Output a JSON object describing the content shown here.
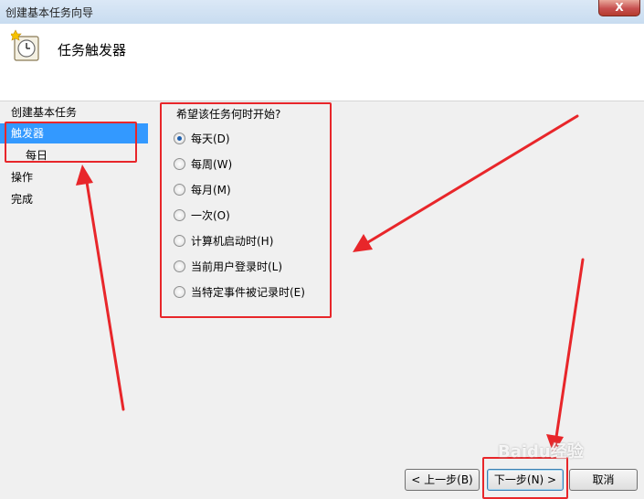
{
  "window": {
    "title": "创建基本任务向导",
    "close_glyph": "X"
  },
  "header": {
    "title": "任务触发器",
    "icon": "clock-icon"
  },
  "sidebar": {
    "items": [
      {
        "label": "创建基本任务",
        "selected": false
      },
      {
        "label": "触发器",
        "selected": true
      },
      {
        "label": "每日",
        "selected": false
      },
      {
        "label": "操作",
        "selected": false
      },
      {
        "label": "完成",
        "selected": false
      }
    ]
  },
  "main": {
    "question": "希望该任务何时开始?",
    "options": [
      {
        "label": "每天(D)",
        "checked": true
      },
      {
        "label": "每周(W)",
        "checked": false
      },
      {
        "label": "每月(M)",
        "checked": false
      },
      {
        "label": "一次(O)",
        "checked": false
      },
      {
        "label": "计算机启动时(H)",
        "checked": false
      },
      {
        "label": "当前用户登录时(L)",
        "checked": false
      },
      {
        "label": "当特定事件被记录时(E)",
        "checked": false
      }
    ]
  },
  "buttons": {
    "back": "< 上一步(B)",
    "next": "下一步(N) >",
    "cancel": "取消"
  },
  "annotation_color": "#e8262a",
  "watermark": "Baidu经验"
}
